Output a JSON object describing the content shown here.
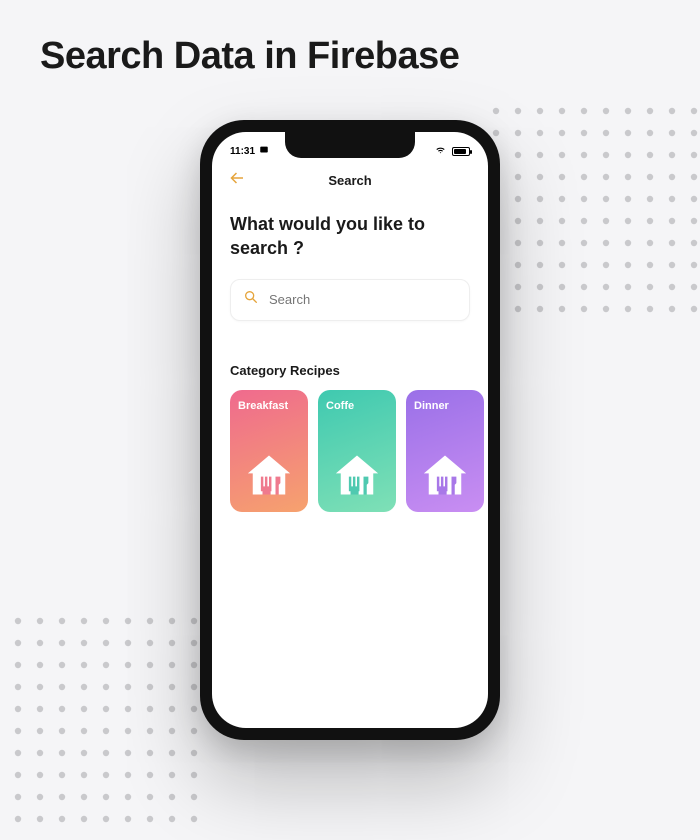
{
  "page": {
    "title": "Search Data in Firebase"
  },
  "status": {
    "time": "11:31"
  },
  "topbar": {
    "title": "Search"
  },
  "prompt": "What would you like to search ?",
  "search": {
    "placeholder": "Search"
  },
  "categories": {
    "title": "Category Recipes",
    "items": [
      {
        "label": "Breakfast"
      },
      {
        "label": "Coffe"
      },
      {
        "label": "Dinner"
      }
    ]
  }
}
